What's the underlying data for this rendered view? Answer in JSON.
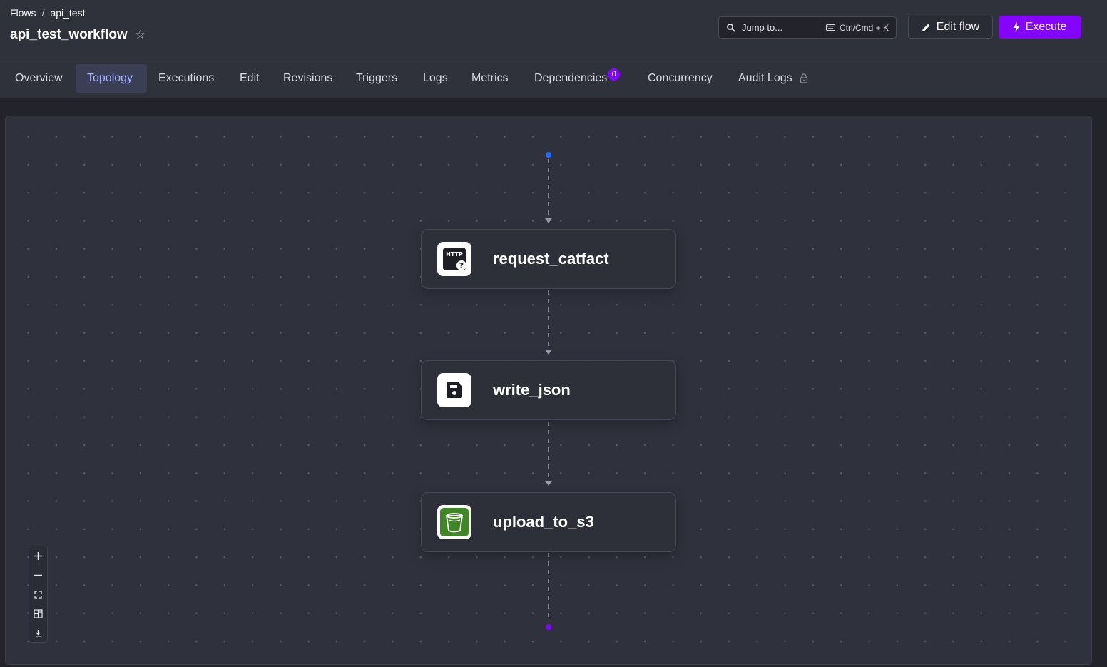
{
  "breadcrumb": {
    "root": "Flows",
    "separator": "/",
    "namespace": "api_test"
  },
  "page": {
    "title": "api_test_workflow",
    "favorite_icon": "star-icon"
  },
  "search": {
    "label": "Jump to...",
    "shortcut": "Ctrl/Cmd + K"
  },
  "actions": {
    "edit_label": "Edit flow",
    "execute_label": "Execute",
    "execute_color": "#8405ff"
  },
  "tabs": [
    {
      "label": "Overview"
    },
    {
      "label": "Topology",
      "active": true
    },
    {
      "label": "Executions"
    },
    {
      "label": "Edit"
    },
    {
      "label": "Revisions"
    },
    {
      "label": "Triggers"
    },
    {
      "label": "Logs"
    },
    {
      "label": "Metrics"
    },
    {
      "label": "Dependencies",
      "badge": "0"
    },
    {
      "label": "Concurrency"
    },
    {
      "label": "Audit Logs",
      "icon": "lock-icon"
    }
  ],
  "topology": {
    "nodes": [
      {
        "label": "request_catfact",
        "icon": "http-icon"
      },
      {
        "label": "write_json",
        "icon": "save-icon"
      },
      {
        "label": "upload_to_s3",
        "icon": "s3-bucket-icon"
      }
    ],
    "start_color": "#1f6cff",
    "end_color": "#8405ff",
    "controls": [
      "zoom-in-icon",
      "zoom-out-icon",
      "fit-view-icon",
      "layout-icon",
      "download-icon"
    ]
  }
}
